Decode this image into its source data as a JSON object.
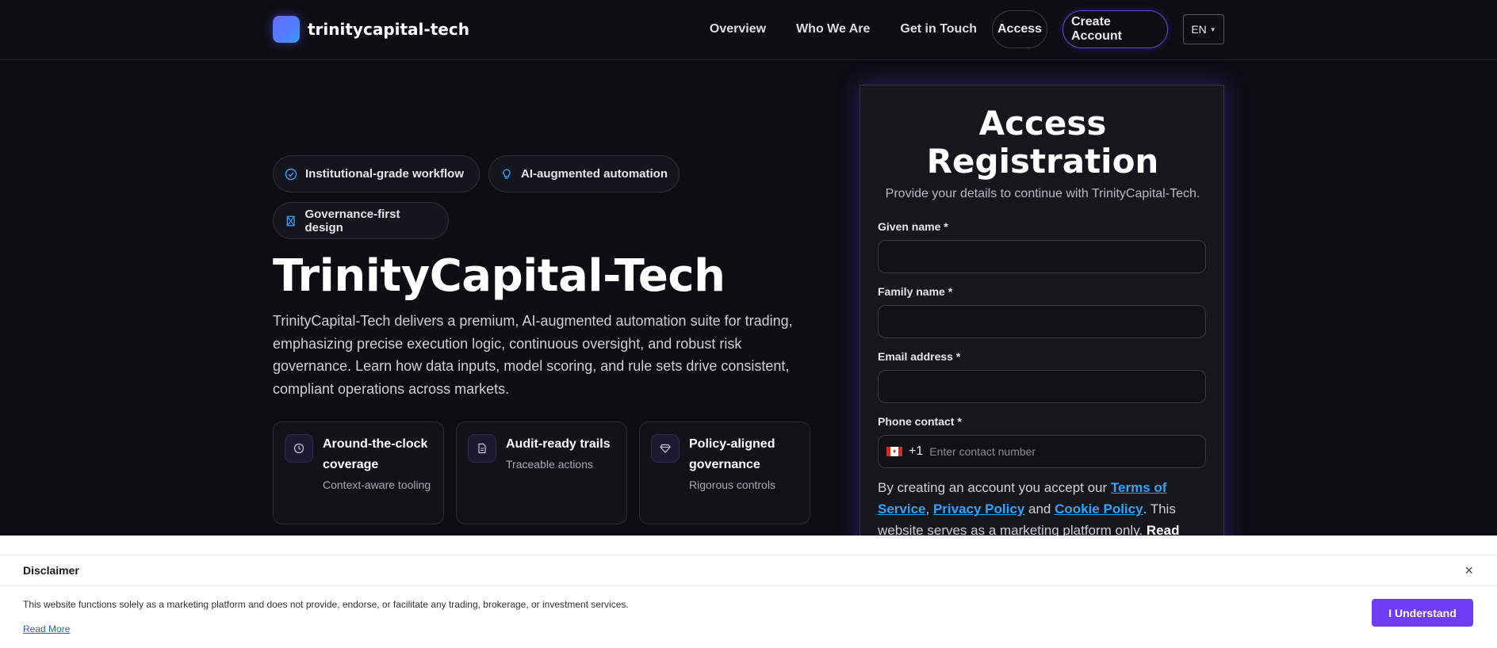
{
  "header": {
    "brand_name": "trinitycapital-tech",
    "nav": [
      "Overview",
      "Who We Are",
      "Get in Touch"
    ],
    "access_label": "Access",
    "create_label": "Create Account",
    "language": "EN"
  },
  "hero": {
    "tags": [
      {
        "label": "Institutional-grade workflow",
        "icon": "check-circle-icon"
      },
      {
        "label": "AI-augmented automation",
        "icon": "lightbulb-icon"
      },
      {
        "label": "Governance-first design",
        "icon": "hourglass-icon"
      }
    ],
    "title": "TrinityCapital-Tech",
    "description": "TrinityCapital-Tech delivers a premium, AI-augmented automation suite for trading, emphasizing precise execution logic, continuous oversight, and robust risk governance. Learn how data inputs, model scoring, and rule sets drive consistent, compliant operations across markets.",
    "features": [
      {
        "title": "Around-the-clock coverage",
        "subtitle": "Context-aware tooling",
        "icon": "clock-icon"
      },
      {
        "title": "Audit-ready trails",
        "subtitle": "Traceable actions",
        "icon": "document-icon"
      },
      {
        "title": "Policy-aligned governance",
        "subtitle": "Rigorous controls",
        "icon": "diamond-icon"
      }
    ]
  },
  "form": {
    "title_line1": "Access",
    "title_line2": "Registration",
    "subtitle": "Provide your details to continue with TrinityCapital-Tech.",
    "given_name_label": "Given name *",
    "given_name_value": "",
    "family_name_label": "Family name *",
    "family_name_value": "",
    "email_label": "Email address *",
    "email_value": "",
    "phone_label": "Phone contact *",
    "phone_code": "+1",
    "phone_placeholder": "Enter contact number",
    "consent_prefix": "By creating an account you accept our ",
    "terms_link": "Terms of Service",
    "comma": ", ",
    "privacy_link": "Privacy Policy",
    "and": " and ",
    "cookie_link": "Cookie Policy",
    "consent_suffix": ". This website serves as a marketing platform only. ",
    "read_more": "Read"
  },
  "disclaimer": {
    "title": "Disclaimer",
    "text": "This website functions solely as a marketing platform and does not provide, endorse, or facilitate any trading, brokerage, or investment services.",
    "read_more": "Read More",
    "button": "I Understand",
    "close": "×"
  },
  "colors": {
    "background": "#0d0d14",
    "accent": "#6e3df5",
    "link": "#2fa4ff"
  }
}
